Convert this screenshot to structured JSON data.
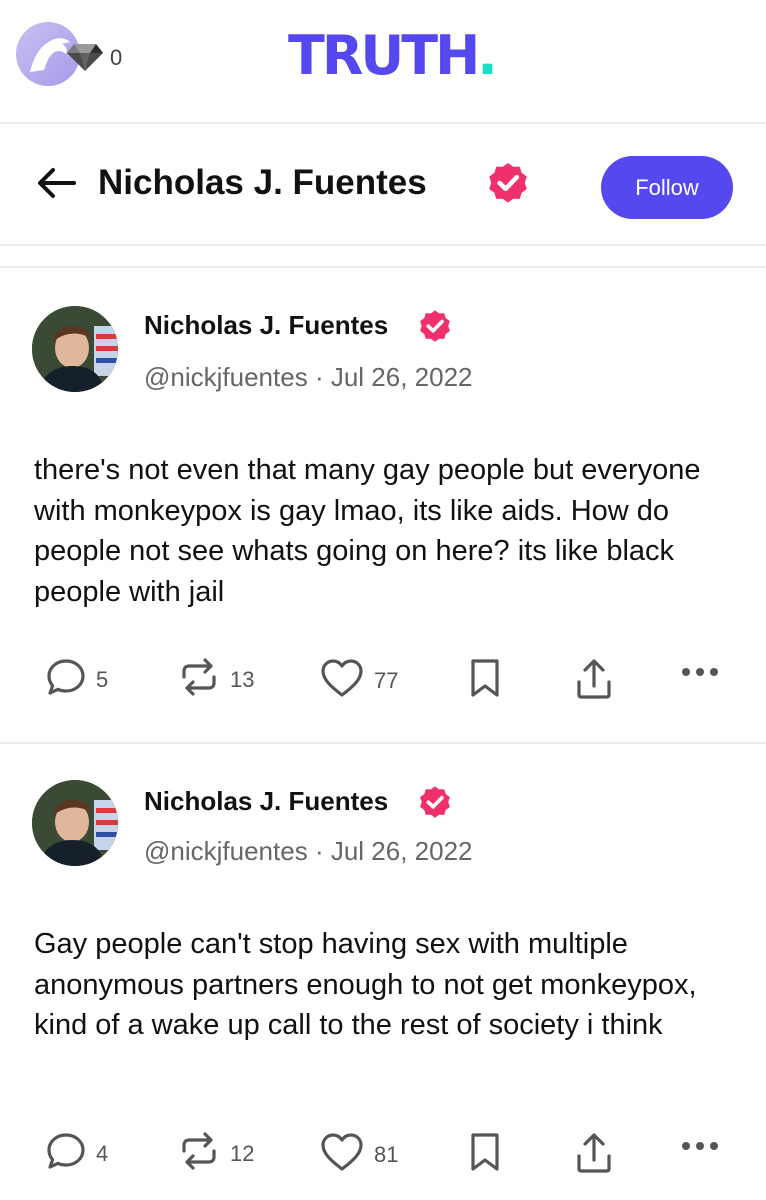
{
  "topbar": {
    "gem_count": "0",
    "logo_text": "TRUTH",
    "logo_dot": "."
  },
  "header": {
    "title": "Nicholas J. Fuentes",
    "follow_label": "Follow"
  },
  "posts": [
    {
      "name": "Nicholas J. Fuentes",
      "handle": "@nickjfuentes",
      "separator": "·",
      "date": "Jul 26, 2022",
      "text": "there's not even that many gay people but everyone with monkeypox is gay lmao, its like aids. How do people not see whats going on here? its like black people with jail",
      "replies": "5",
      "retruths": "13",
      "likes": "77"
    },
    {
      "name": "Nicholas J. Fuentes",
      "handle": "@nickjfuentes",
      "separator": "·",
      "date": "Jul 26, 2022",
      "text": "Gay people can't stop having sex with multiple anonymous partners enough to not get monkeypox, kind of a wake up call to the rest of society i think",
      "replies": "4",
      "retruths": "12",
      "likes": "81"
    }
  ],
  "colors": {
    "brand": "#5448ee",
    "verified": "#f0306b",
    "logo_dot": "#17e0c4"
  }
}
